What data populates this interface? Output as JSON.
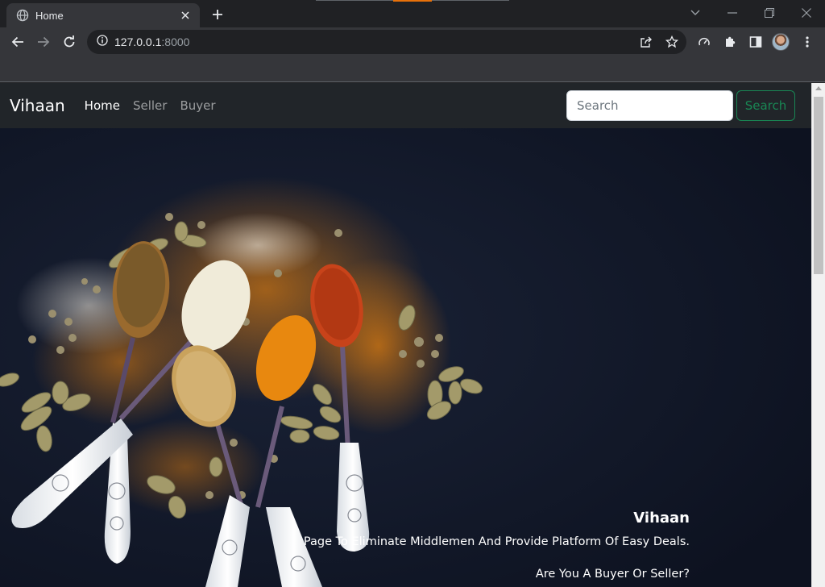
{
  "browser": {
    "tab_title": "Home",
    "url_host": "127.0.0.1",
    "url_port": ":8000",
    "icons": [
      "globe-icon",
      "close-icon",
      "plus-icon",
      "chevron-down-icon",
      "minimize-icon",
      "restore-icon",
      "window-close-icon",
      "back-arrow-icon",
      "forward-arrow-icon",
      "reload-icon",
      "info-icon",
      "share-icon",
      "star-icon",
      "performance-icon",
      "extensions-icon",
      "side-panel-icon",
      "kebab-menu-icon"
    ]
  },
  "navbar": {
    "brand": "Vihaan",
    "links": [
      "Home",
      "Seller",
      "Buyer"
    ],
    "search_placeholder": "Search",
    "search_button": "Search"
  },
  "hero": {
    "title": "Vihaan",
    "text": "Page To Eliminate Middlemen And Provide Platform Of Easy Deals.",
    "question": "Are You A Buyer Or Seller?"
  },
  "colors": {
    "navbar_bg": "#212529",
    "success": "#198754",
    "hero_bg": "#121826"
  }
}
